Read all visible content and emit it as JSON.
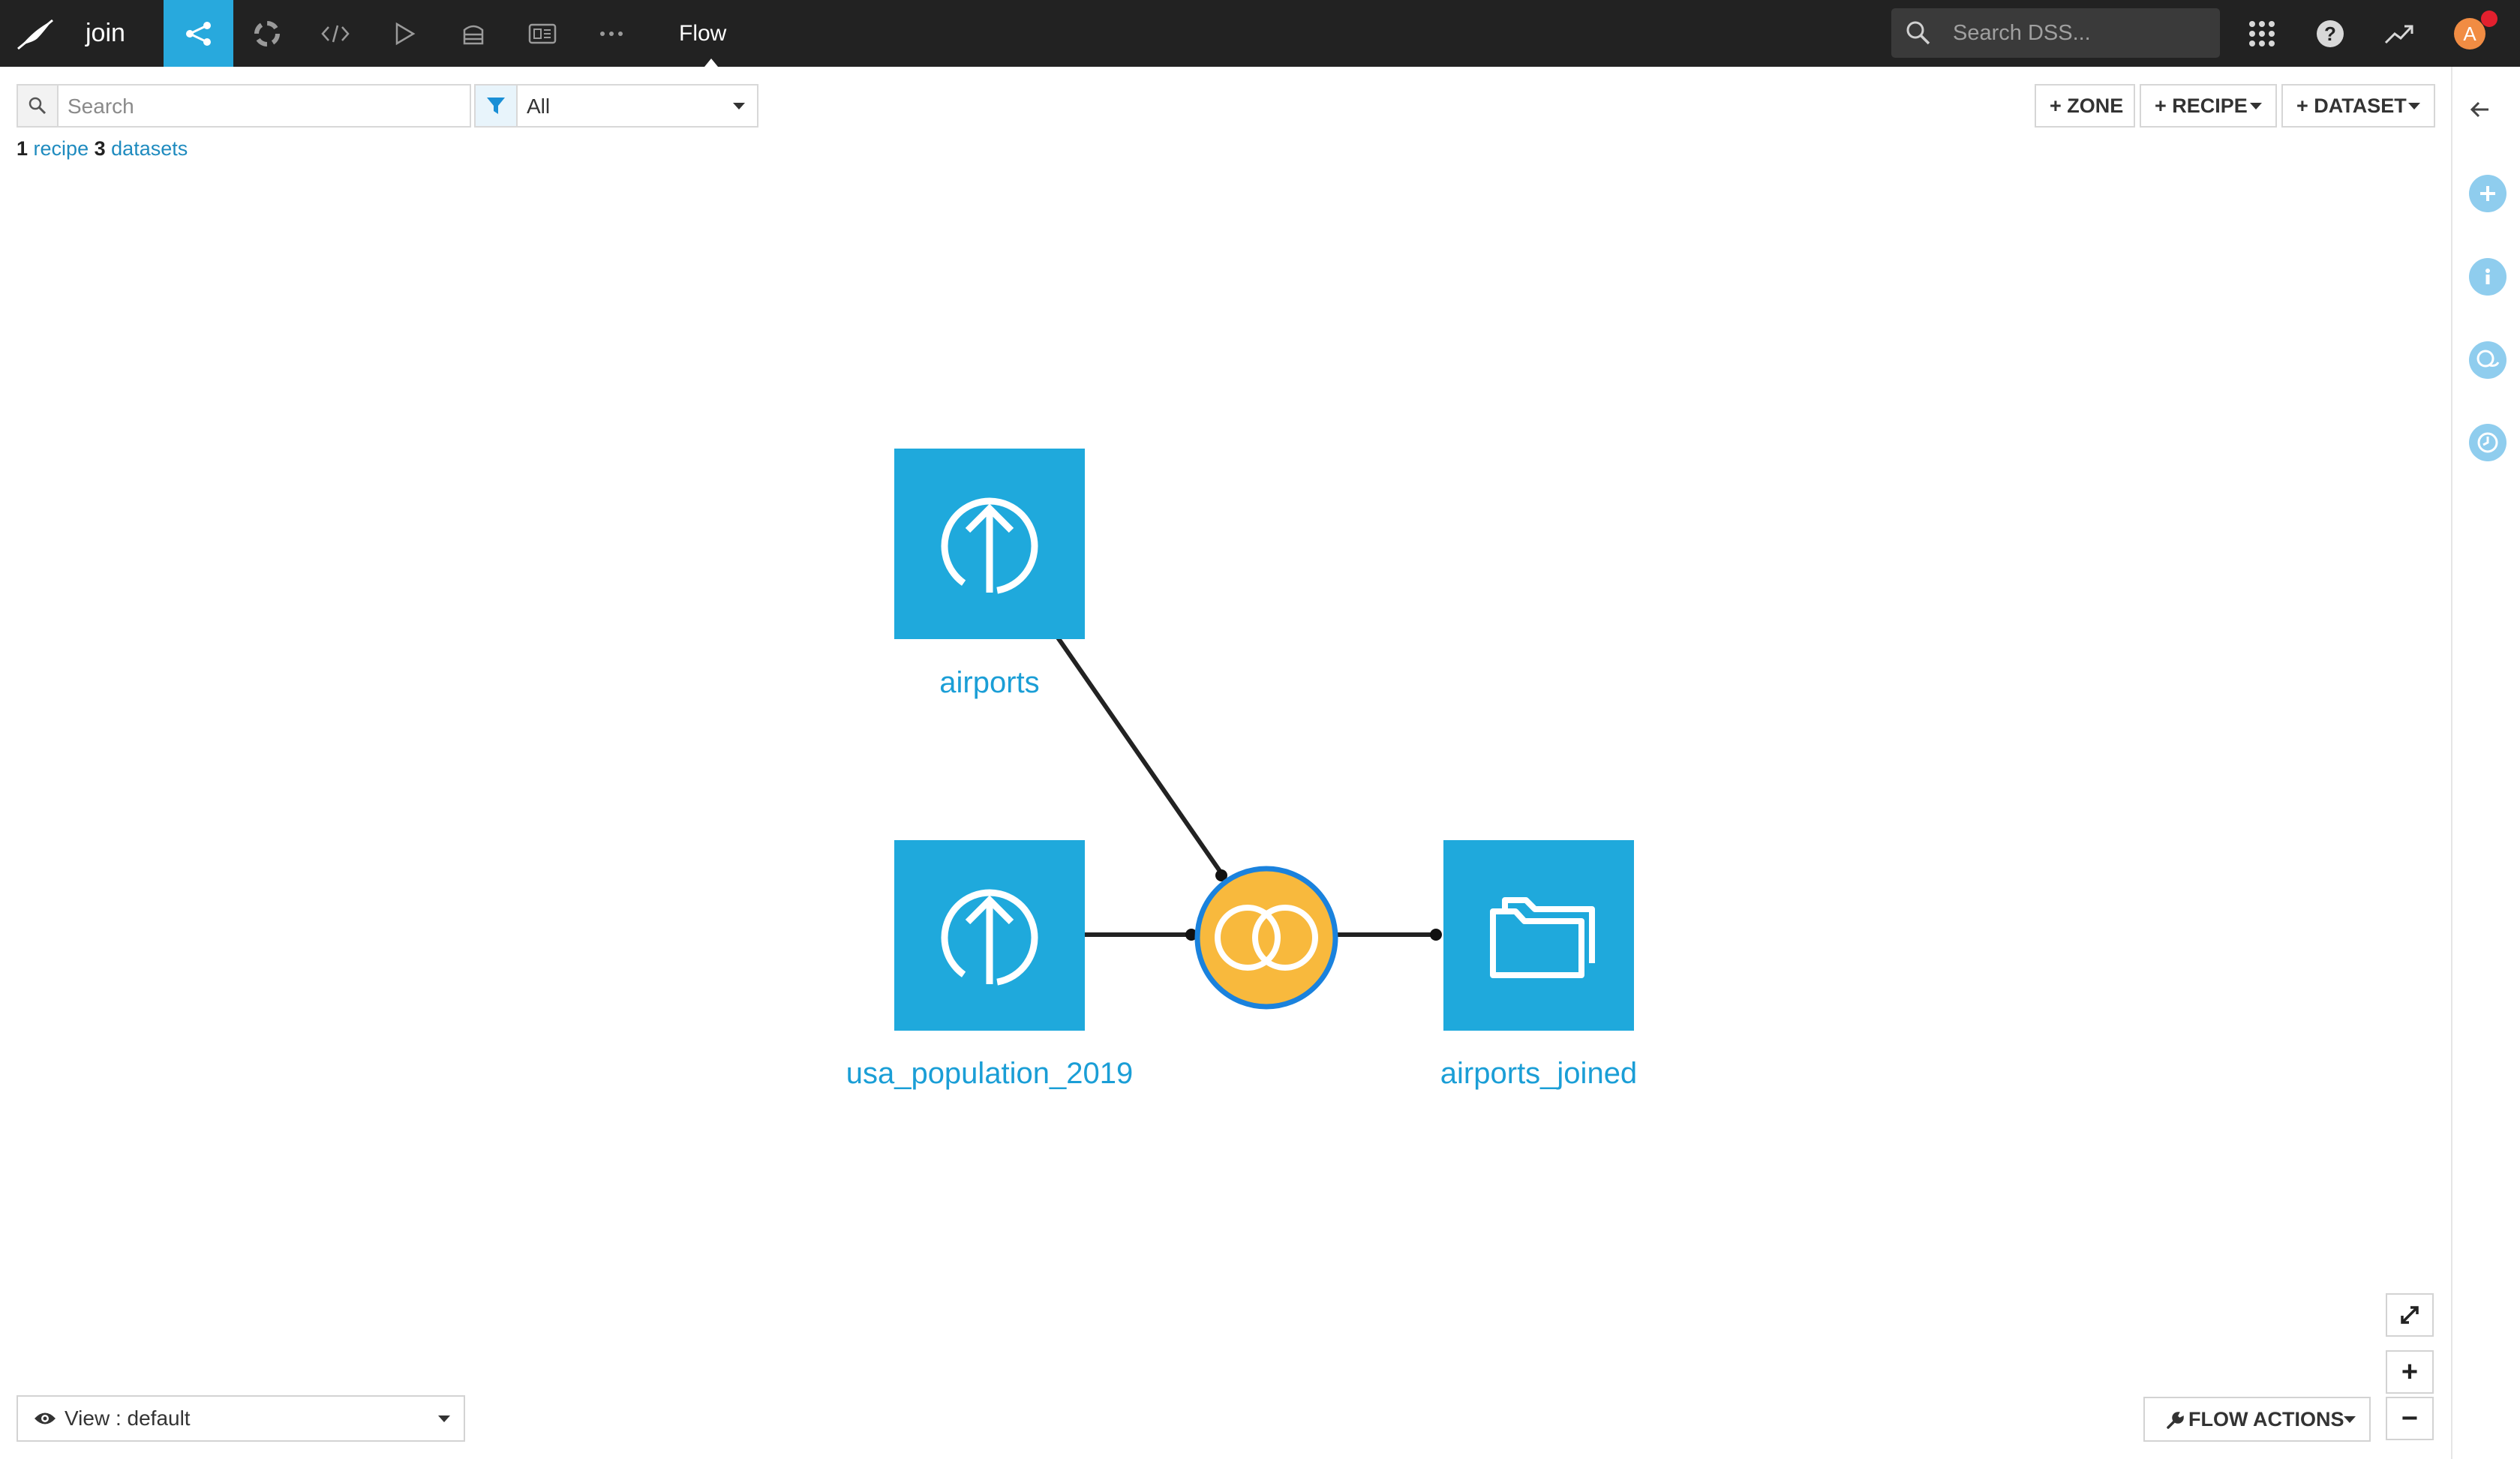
{
  "header": {
    "project_name": "join",
    "current_view": "Flow",
    "search_placeholder": "Search DSS...",
    "avatar_initial": "A",
    "nav_icons": [
      "flow-icon",
      "lab-icon",
      "code-icon",
      "run-icon",
      "deploy-icon",
      "dashboard-icon",
      "more-icon"
    ]
  },
  "toolbar": {
    "search_placeholder": "Search",
    "filter_value": "All",
    "zone_label": "+ ZONE",
    "recipe_label": "+ RECIPE",
    "dataset_label": "+ DATASET"
  },
  "summary": {
    "recipe_count": "1",
    "recipe_label": "recipe",
    "dataset_count": "3",
    "dataset_label": "datasets"
  },
  "flow": {
    "datasets": [
      {
        "name": "airports",
        "icon": "upload-icon"
      },
      {
        "name": "usa_population_2019",
        "icon": "upload-icon"
      },
      {
        "name": "airports_joined",
        "icon": "folder-icon"
      }
    ],
    "recipe": {
      "type": "join",
      "icon": "join-icon"
    },
    "colors": {
      "dataset": "#1fa9dc",
      "recipe_fill": "#f8b93d",
      "recipe_border": "#1a82dd",
      "edge": "#222222",
      "label": "#1a9ed6"
    }
  },
  "bottom": {
    "view_label": "View : default",
    "flow_actions_label": "FLOW ACTIONS",
    "zoom_in": "+",
    "zoom_out": "−"
  },
  "right_panel": {
    "icons": [
      "collapse-arrow-icon",
      "add-icon",
      "info-icon",
      "discussions-icon",
      "history-icon"
    ]
  }
}
